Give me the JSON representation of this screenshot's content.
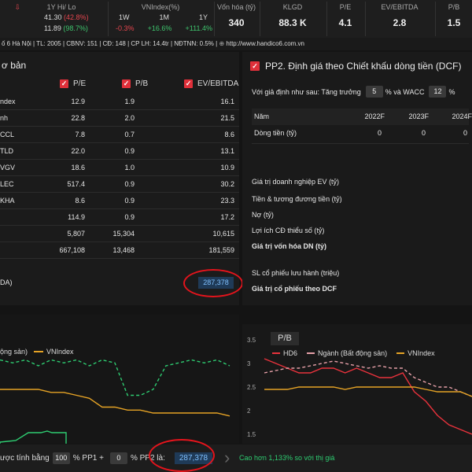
{
  "topbar": {
    "hilo_label": "1Y Hi/ Lo",
    "hi": "41.30",
    "hi_pct": "(42.8%)",
    "lo": "11.89",
    "lo_pct": "(98.7%)",
    "vnindex_label": "VNIndex(%)",
    "periods": [
      "1W",
      "1M",
      "1Y"
    ],
    "period_vals": [
      "-0.3%",
      "+16.6%",
      "+111.4%"
    ],
    "stats": [
      {
        "label": "Vốn hóa (tỷ)",
        "value": "340"
      },
      {
        "label": "KLGD",
        "value": "88.3 K"
      },
      {
        "label": "P/E",
        "value": "4.1"
      },
      {
        "label": "EV/EBITDA",
        "value": "2.8"
      },
      {
        "label": "P/B",
        "value": "1.5"
      }
    ],
    "colors": {
      "red": "#e4454e",
      "green": "#3ec46d"
    }
  },
  "infobar": {
    "text": "ố 6 Hà Nội | TL: 2005 | CBNV: 151 | CĐ: 148 | CP LH: 14.4tr | NĐTNN: 0.5% |",
    "url": "http://www.handico6.com.vn"
  },
  "pp1": {
    "title": "ơ bản",
    "col_headers": [
      "P/E",
      "P/B",
      "EV/EBITDA"
    ],
    "rows": [
      {
        "name": "ndex",
        "pe": "12.9",
        "pb": "1.9",
        "ev": "16.1"
      },
      {
        "name": "nh",
        "pe": "22.8",
        "pb": "2.0",
        "ev": "21.5"
      },
      {
        "name": "CCL",
        "pe": "7.8",
        "pb": "0.7",
        "ev": "8.6"
      },
      {
        "name": "TLD",
        "pe": "22.0",
        "pb": "0.9",
        "ev": "13.1"
      },
      {
        "name": "VGV",
        "pe": "18.6",
        "pb": "1.0",
        "ev": "10.9"
      },
      {
        "name": "LEC",
        "pe": "517.4",
        "pb": "0.9",
        "ev": "30.2"
      },
      {
        "name": "KHA",
        "pe": "8.6",
        "pb": "0.9",
        "ev": "23.3"
      },
      {
        "name": "",
        "pe": "114.9",
        "pb": "0.9",
        "ev": "17.2"
      },
      {
        "name": "",
        "pe": "5,807",
        "pb": "15,304",
        "ev": "10,615"
      },
      {
        "name": "",
        "pe": "667,108",
        "pb": "13,468",
        "ev": "181,559"
      }
    ],
    "result_label": "DA)",
    "result_value": "287,378"
  },
  "pp2": {
    "title": "PP2. Định giá theo Chiết khấu dòng tiền (DCF)",
    "assumption_prefix": "Với giả định như sau: Tăng trưởng",
    "growth": "5",
    "wacc_mid": "% và WACC",
    "wacc": "12",
    "pct": "%",
    "table_headers": [
      "Năm",
      "2022F",
      "2023F",
      "2024F"
    ],
    "cashflow_label": "Dòng tiền (tỷ)",
    "cashflow_values": [
      "0",
      "0",
      "0"
    ],
    "lines": [
      "Giá trị doanh nghiệp EV (tỷ)",
      "Tiền & tương đương tiền (tỷ)",
      "Nợ (tỷ)",
      "Lợi ích CĐ thiểu số (tỷ)",
      "Giá trị vốn hóa DN (tỷ)"
    ],
    "shares_label": "SL cổ phiếu lưu hành (triệu)",
    "price_label": "Giá trị cổ phiếu theo DCF"
  },
  "chart_left": {
    "legend": [
      "ộng sản)",
      "VNIndex"
    ]
  },
  "chart_right": {
    "title": "P/B",
    "legend": [
      "HD6",
      "Ngành (Bất động sản)",
      "VNIndex"
    ],
    "yticks": [
      "3.5",
      "3",
      "2.5",
      "2",
      "1.5"
    ]
  },
  "chart_data": [
    {
      "type": "line",
      "title": "",
      "series": [
        {
          "name": "ộng sản)",
          "color": "#2ecc71",
          "values": [
            2.6,
            2.55,
            2.6,
            2.5,
            2.6,
            2.55,
            2.6,
            2.5,
            2.6,
            2.55,
            2.0,
            2.0,
            2.1,
            2.5,
            2.55,
            2.6,
            2.55,
            2.6,
            2.5
          ]
        },
        {
          "name": "VNIndex",
          "color": "#e6a325",
          "values": [
            2.1,
            2.1,
            2.1,
            2.1,
            2.05,
            2.05,
            2.0,
            1.95,
            1.8,
            1.8,
            1.75,
            1.75,
            1.7,
            1.7,
            1.7,
            1.7,
            1.7,
            1.7,
            1.65
          ]
        }
      ]
    },
    {
      "type": "line",
      "title": "P/B",
      "ylim": [
        1.5,
        3.5
      ],
      "series": [
        {
          "name": "HD6",
          "color": "#e8323c",
          "values": [
            3.1,
            3.0,
            2.9,
            2.8,
            2.8,
            2.9,
            2.9,
            2.8,
            2.9,
            2.8,
            2.7,
            2.7,
            2.8,
            2.4,
            2.2,
            1.9,
            1.7,
            1.6,
            1.5
          ]
        },
        {
          "name": "Ngành (Bất động sản)",
          "color": "#e6a0a8",
          "values": [
            2.8,
            2.85,
            2.9,
            2.9,
            2.95,
            3.0,
            3.05,
            3.0,
            2.95,
            2.9,
            2.95,
            2.9,
            2.9,
            2.7,
            2.6,
            2.5,
            2.5,
            2.4,
            2.3
          ]
        },
        {
          "name": "VNIndex",
          "color": "#e6a325",
          "values": [
            2.45,
            2.45,
            2.45,
            2.5,
            2.5,
            2.5,
            2.5,
            2.45,
            2.5,
            2.5,
            2.5,
            2.5,
            2.5,
            2.5,
            2.45,
            2.4,
            2.4,
            2.4,
            2.3
          ]
        }
      ]
    }
  ],
  "bottombar": {
    "prefix": "ược tính bằng",
    "pp1_weight": "100",
    "pp1_label": "% PP1 +",
    "pp2_weight": "0",
    "pp2_label": "% PP2 là:",
    "result": "287,378",
    "note": "Cao hơn 1,133% so với thị giá"
  }
}
